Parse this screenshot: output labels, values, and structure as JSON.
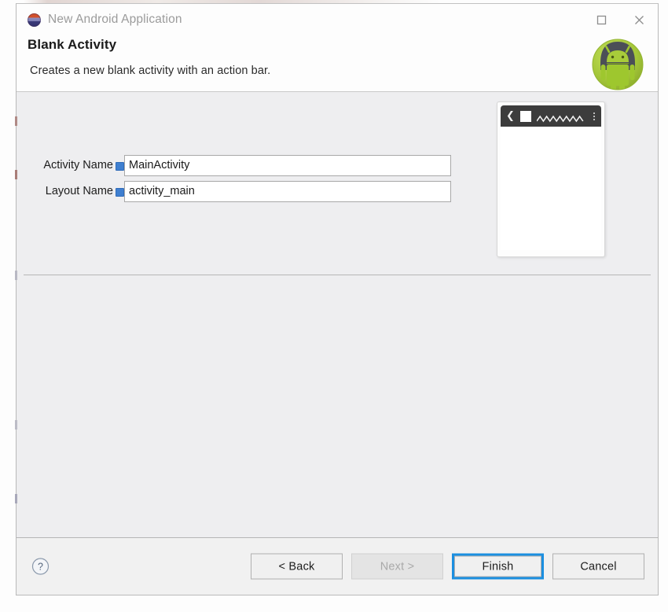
{
  "window": {
    "title": "New Android Application",
    "app_icon": "android-circle-icon",
    "controls": [
      {
        "name": "maximize-button",
        "glyph": "square"
      },
      {
        "name": "close-button",
        "glyph": "x"
      }
    ]
  },
  "header": {
    "title": "Blank Activity",
    "description": "Creates a new blank activity with an action bar.",
    "logo": "android-mascot-icon"
  },
  "form": {
    "fields": [
      {
        "label": "Activity Name",
        "value": "MainActivity",
        "placeholder": "",
        "info_icon": "info-marker-icon",
        "name": "activity-name"
      },
      {
        "label": "Layout Name",
        "value": "activity_main",
        "placeholder": "",
        "info_icon": "info-marker-icon",
        "name": "layout-name"
      }
    ]
  },
  "preview": {
    "name": "activity-preview-thumbnail",
    "action_bar": {
      "back_icon": "chevron-left-icon",
      "app_icon": "app-square-icon",
      "title_placeholder": "zigzag-placeholder",
      "overflow_icon": "overflow-menu-icon"
    }
  },
  "buttons": {
    "help": "?",
    "back": "< Back",
    "next": "Next >",
    "finish": "Finish",
    "cancel": "Cancel"
  },
  "colors": {
    "focus_ring": "#1b8fe0",
    "android_green": "#a4c639",
    "action_bar": "#3c3c3c",
    "info_blue": "#3f7fd0",
    "body_gray": "#eeeef0"
  }
}
